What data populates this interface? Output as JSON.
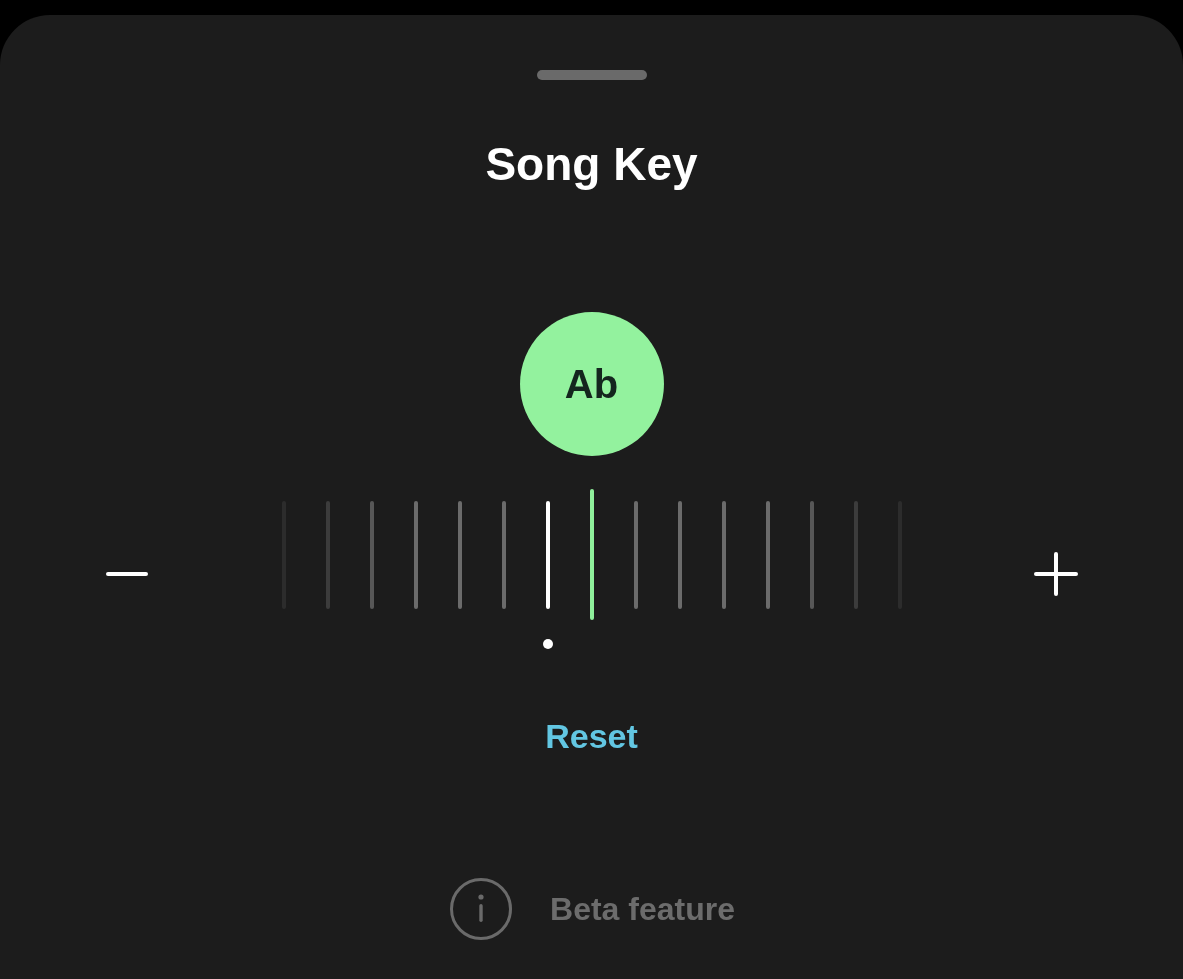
{
  "sheet": {
    "title": "Song Key"
  },
  "key": {
    "label": "Ab"
  },
  "pitch_ruler": {
    "ticks": [
      {
        "selected": false,
        "original": false
      },
      {
        "selected": false,
        "original": false
      },
      {
        "selected": false,
        "original": false
      },
      {
        "selected": false,
        "original": false
      },
      {
        "selected": false,
        "original": false
      },
      {
        "selected": false,
        "original": false
      },
      {
        "selected": false,
        "original": true
      },
      {
        "selected": true,
        "original": false
      },
      {
        "selected": false,
        "original": false
      },
      {
        "selected": false,
        "original": false
      },
      {
        "selected": false,
        "original": false
      },
      {
        "selected": false,
        "original": false
      },
      {
        "selected": false,
        "original": false
      },
      {
        "selected": false,
        "original": false
      },
      {
        "selected": false,
        "original": false
      }
    ]
  },
  "reset": {
    "label": "Reset"
  },
  "footer": {
    "label": "Beta feature"
  }
}
